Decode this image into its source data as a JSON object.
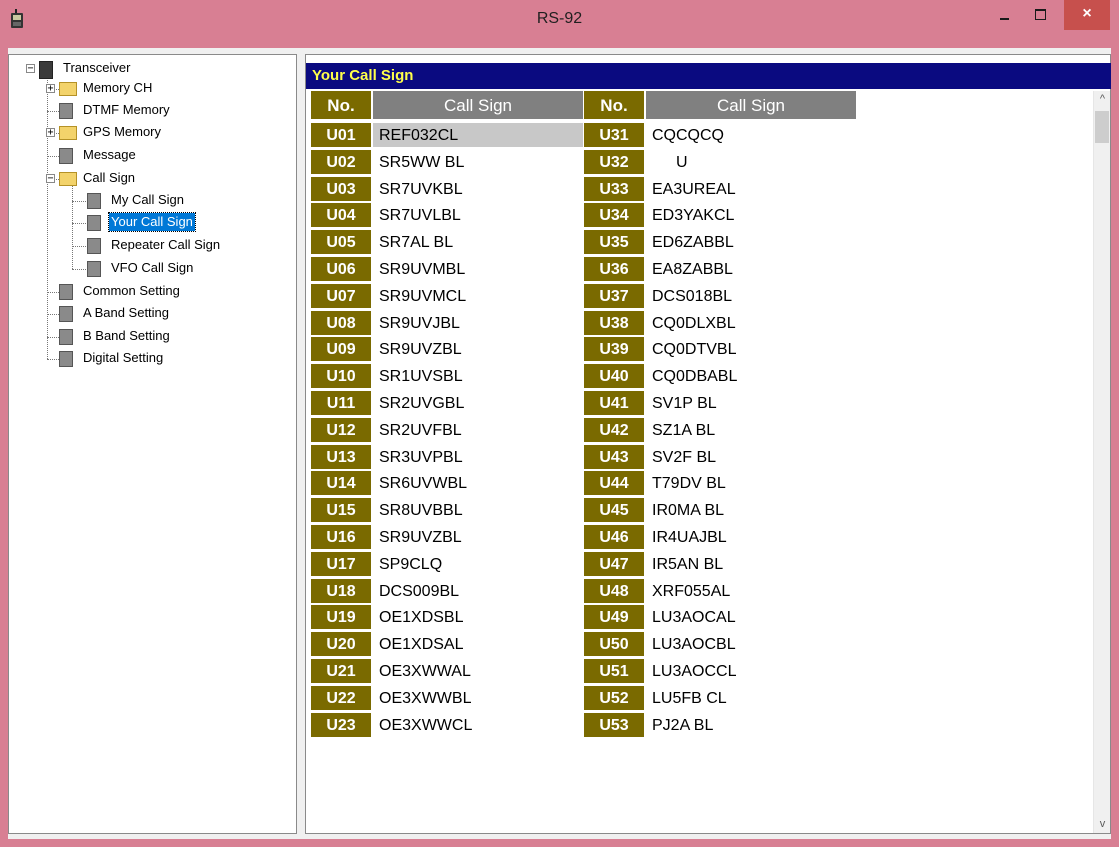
{
  "window": {
    "title": "RS-92",
    "min_icon": "minimize-icon",
    "max_icon": "maximize-icon",
    "close_icon": "close-icon",
    "close_glyph": "×"
  },
  "tree": {
    "items": [
      {
        "label": "Transceiver",
        "icon": "radio-icon"
      },
      {
        "label": "Memory CH",
        "icon": "folder-icon"
      },
      {
        "label": "DTMF Memory",
        "icon": "page-icon"
      },
      {
        "label": "GPS Memory",
        "icon": "folder-icon"
      },
      {
        "label": "Message",
        "icon": "page-icon"
      },
      {
        "label": "Call Sign",
        "icon": "folder-icon"
      },
      {
        "label": "My Call Sign",
        "icon": "page-icon"
      },
      {
        "label": "Your Call Sign",
        "icon": "page-icon"
      },
      {
        "label": "Repeater Call Sign",
        "icon": "page-icon"
      },
      {
        "label": "VFO Call Sign",
        "icon": "page-icon"
      },
      {
        "label": "Common Setting",
        "icon": "page-icon"
      },
      {
        "label": "A Band Setting",
        "icon": "page-icon"
      },
      {
        "label": "B Band Setting",
        "icon": "page-icon"
      },
      {
        "label": "Digital Setting",
        "icon": "page-icon"
      }
    ],
    "expander_minus": "−",
    "expander_plus": "+"
  },
  "panel": {
    "title": "Your Call Sign",
    "col_no": "No.",
    "col_callsign": "Call Sign",
    "left": [
      [
        "U01",
        "REF032CL"
      ],
      [
        "U02",
        "SR5WW BL"
      ],
      [
        "U03",
        "SR7UVKBL"
      ],
      [
        "U04",
        "SR7UVLBL"
      ],
      [
        "U05",
        "SR7AL BL"
      ],
      [
        "U06",
        "SR9UVMBL"
      ],
      [
        "U07",
        "SR9UVMCL"
      ],
      [
        "U08",
        "SR9UVJBL"
      ],
      [
        "U09",
        "SR9UVZBL"
      ],
      [
        "U10",
        "SR1UVSBL"
      ],
      [
        "U11",
        "SR2UVGBL"
      ],
      [
        "U12",
        "SR2UVFBL"
      ],
      [
        "U13",
        "SR3UVPBL"
      ],
      [
        "U14",
        "SR6UVWBL"
      ],
      [
        "U15",
        "SR8UVBBL"
      ],
      [
        "U16",
        "SR9UVZBL"
      ],
      [
        "U17",
        "SP9CLQ"
      ],
      [
        "U18",
        "DCS009BL"
      ],
      [
        "U19",
        "OE1XDSBL"
      ],
      [
        "U20",
        "OE1XDSAL"
      ],
      [
        "U21",
        "OE3XWWAL"
      ],
      [
        "U22",
        "OE3XWWBL"
      ],
      [
        "U23",
        "OE3XWWCL"
      ]
    ],
    "right": [
      [
        "U31",
        "CQCQCQ"
      ],
      [
        "U32",
        "U"
      ],
      [
        "U33",
        "EA3UREAL"
      ],
      [
        "U34",
        "ED3YAKCL"
      ],
      [
        "U35",
        "ED6ZABBL"
      ],
      [
        "U36",
        "EA8ZABBL"
      ],
      [
        "U37",
        "DCS018BL"
      ],
      [
        "U38",
        "CQ0DLXBL"
      ],
      [
        "U39",
        "CQ0DTVBL"
      ],
      [
        "U40",
        "CQ0DBABL"
      ],
      [
        "U41",
        "SV1P BL"
      ],
      [
        "U42",
        "SZ1A BL"
      ],
      [
        "U43",
        "SV2F BL"
      ],
      [
        "U44",
        "T79DV BL"
      ],
      [
        "U45",
        "IR0MA BL"
      ],
      [
        "U46",
        "IR4UAJBL"
      ],
      [
        "U47",
        "IR5AN BL"
      ],
      [
        "U48",
        "XRF055AL"
      ],
      [
        "U49",
        "LU3AOCAL"
      ],
      [
        "U50",
        "LU3AOCBL"
      ],
      [
        "U51",
        "LU3AOCCL"
      ],
      [
        "U52",
        "LU5FB CL"
      ],
      [
        "U53",
        "PJ2A BL"
      ]
    ],
    "selected_cell": "U01"
  },
  "scrollbar": {
    "up_glyph": "^",
    "down_glyph": "v"
  },
  "colors": {
    "titlebar": "#d87f93",
    "number_cell": "#7a6a00",
    "header_bar": "#0a0a80",
    "header_text": "#ffff4a",
    "selection": "#0078d7"
  }
}
